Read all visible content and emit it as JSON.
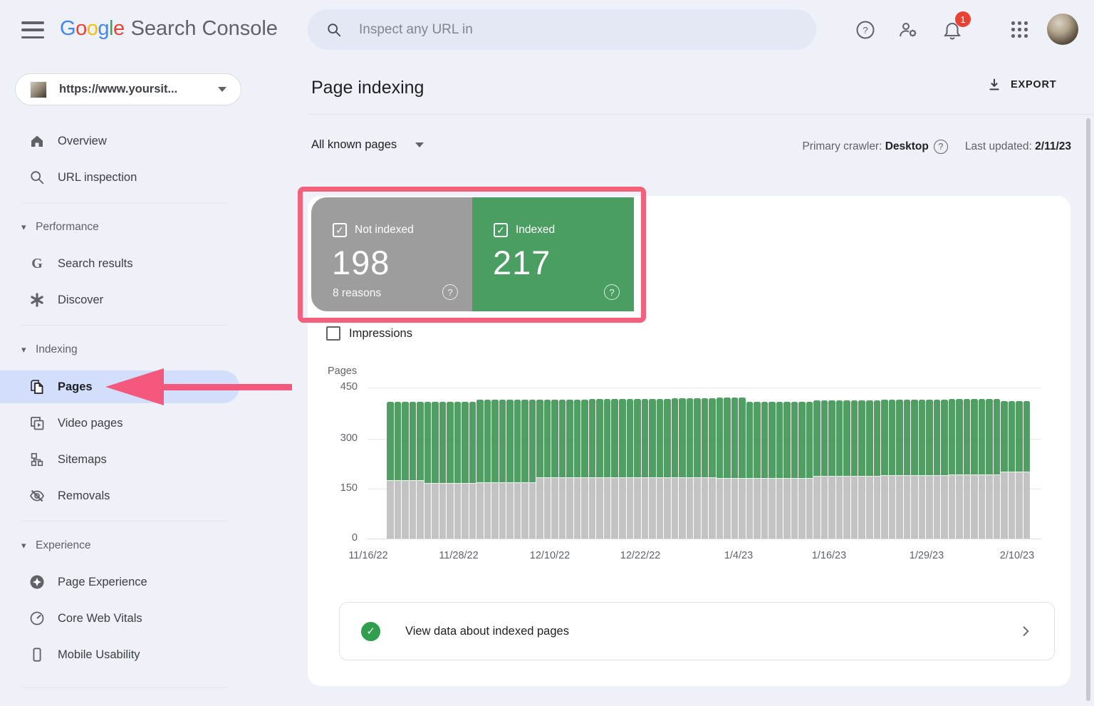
{
  "topbar": {
    "search_placeholder": "Inspect any URL in",
    "product_name": "Search Console",
    "logo_letters": [
      {
        "ch": "G",
        "color": "#4285F4"
      },
      {
        "ch": "o",
        "color": "#EA4335"
      },
      {
        "ch": "o",
        "color": "#FBBC05"
      },
      {
        "ch": "g",
        "color": "#4285F4"
      },
      {
        "ch": "l",
        "color": "#34A853"
      },
      {
        "ch": "e",
        "color": "#EA4335"
      }
    ],
    "notification_count": "1"
  },
  "property_selector": {
    "url": "https://www.yoursit..."
  },
  "sidebar": {
    "sections": {
      "performance": "Performance",
      "indexing": "Indexing",
      "experience": "Experience"
    },
    "items": {
      "overview": "Overview",
      "url_inspection": "URL inspection",
      "search_results": "Search results",
      "discover": "Discover",
      "pages": "Pages",
      "video_pages": "Video pages",
      "sitemaps": "Sitemaps",
      "removals": "Removals",
      "page_experience": "Page Experience",
      "core_web_vitals": "Core Web Vitals",
      "mobile_usability": "Mobile Usability"
    }
  },
  "header": {
    "title": "Page indexing",
    "export_label": "EXPORT"
  },
  "filter_bar": {
    "scope": "All known pages",
    "crawler_label": "Primary crawler:",
    "crawler_value": "Desktop",
    "updated_label": "Last updated:",
    "updated_value": "2/11/23"
  },
  "summary": {
    "not_indexed": {
      "label": "Not indexed",
      "value": "198",
      "sub": "8 reasons",
      "color": "#9d9d9d",
      "checked": true
    },
    "indexed": {
      "label": "Indexed",
      "value": "217",
      "color": "#4b9e62",
      "checked": true
    }
  },
  "impressions": {
    "label": "Impressions",
    "checked": false
  },
  "chart_data": {
    "type": "bar",
    "stacked": true,
    "ylabel": "Pages",
    "ylim": [
      0,
      450
    ],
    "yticks": [
      450,
      300,
      150,
      0
    ],
    "grid": true,
    "x_tick_labels": [
      "11/16/22",
      "11/28/22",
      "12/10/22",
      "12/22/22",
      "1/4/23",
      "1/16/23",
      "1/29/23",
      "2/10/23"
    ],
    "date_range": [
      "11/16/22",
      "2/11/23"
    ],
    "series": [
      {
        "name": "Not indexed",
        "color": "#c3c3c3",
        "values": [
          172,
          172,
          172,
          172,
          172,
          164,
          164,
          164,
          164,
          164,
          164,
          164,
          166,
          166,
          166,
          166,
          166,
          166,
          166,
          166,
          180,
          180,
          180,
          180,
          180,
          180,
          180,
          181,
          181,
          181,
          181,
          181,
          181,
          181,
          181,
          181,
          181,
          181,
          181,
          181,
          181,
          181,
          181,
          181,
          178,
          178,
          178,
          178,
          179,
          179,
          179,
          179,
          179,
          179,
          179,
          179,
          179,
          185,
          185,
          185,
          185,
          185,
          185,
          185,
          185,
          185,
          187,
          187,
          187,
          187,
          187,
          187,
          187,
          187,
          187,
          189,
          189,
          189,
          189,
          189,
          189,
          189,
          198,
          198,
          198,
          198
        ]
      },
      {
        "name": "Indexed",
        "color": "#4f9f63",
        "values": [
          236,
          236,
          236,
          236,
          236,
          243,
          243,
          243,
          243,
          243,
          243,
          243,
          248,
          248,
          248,
          248,
          248,
          248,
          248,
          248,
          234,
          234,
          234,
          234,
          234,
          234,
          234,
          235,
          235,
          235,
          235,
          235,
          235,
          235,
          235,
          235,
          235,
          235,
          237,
          237,
          237,
          237,
          237,
          237,
          242,
          242,
          242,
          242,
          229,
          229,
          229,
          229,
          229,
          229,
          229,
          229,
          229,
          227,
          227,
          227,
          227,
          227,
          227,
          227,
          227,
          227,
          227,
          227,
          227,
          227,
          227,
          227,
          227,
          227,
          227,
          227,
          227,
          227,
          227,
          227,
          227,
          227,
          212,
          212,
          212,
          212
        ]
      }
    ]
  },
  "footer": {
    "text": "View data about indexed pages"
  }
}
